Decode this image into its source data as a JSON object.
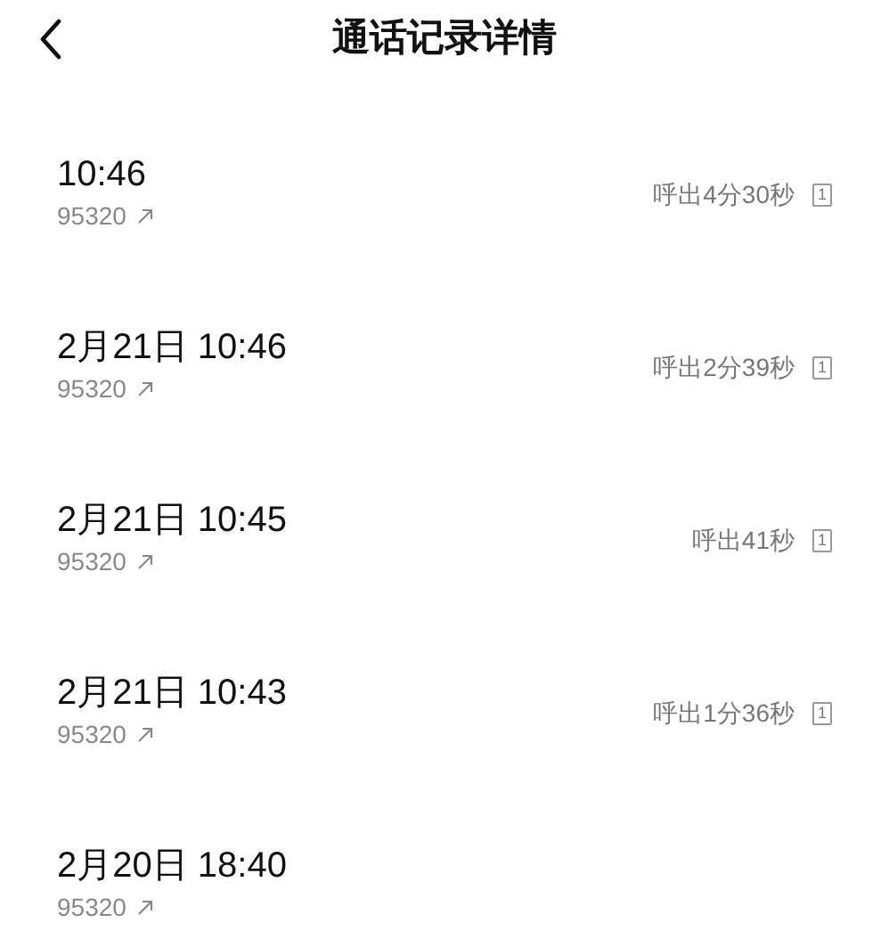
{
  "header": {
    "title": "通话记录详情"
  },
  "calls": [
    {
      "time": "10:46",
      "number": "95320",
      "duration": "呼出4分30秒",
      "sim": "1"
    },
    {
      "time": "2月21日 10:46",
      "number": "95320",
      "duration": "呼出2分39秒",
      "sim": "1"
    },
    {
      "time": "2月21日 10:45",
      "number": "95320",
      "duration": "呼出41秒",
      "sim": "1"
    },
    {
      "time": "2月21日 10:43",
      "number": "95320",
      "duration": "呼出1分36秒",
      "sim": "1"
    },
    {
      "time": "2月20日 18:40",
      "number": "95320"
    }
  ]
}
